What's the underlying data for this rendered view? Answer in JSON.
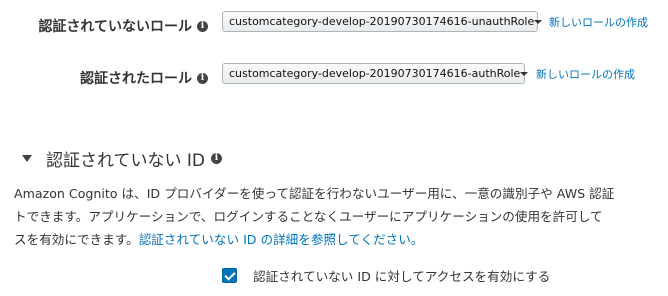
{
  "unauth_role": {
    "label": "認証されていないロール",
    "selected": "customcategory-develop-20190730174616-unauthRole",
    "create_link": "新しいロールの作成"
  },
  "auth_role": {
    "label": "認証されたロール",
    "selected": "customcategory-develop-20190730174616-authRole",
    "create_link": "新しいロールの作成"
  },
  "section": {
    "title": "認証されていない ID",
    "description_lines": [
      "Amazon Cognito は、ID プロバイダーを使って認証を行わないユーザー用に、一意の識別子や AWS 認証",
      "トできます。アプリケーションで、ログインすることなくユーザーにアプリケーションの使用を許可して",
      "スを有効にできます。"
    ],
    "details_link": "認証されていない ID の詳細を参照してください。",
    "checkbox_label": "認証されていない ID に対してアクセスを有効にする",
    "checkbox_checked": true
  },
  "icons": {
    "info": "i",
    "info_name": "info-icon",
    "caret_name": "caret-down-icon",
    "section_toggle_name": "triangle-down-icon"
  },
  "colors": {
    "link": "#0073bb",
    "checkbox": "#0073bb",
    "text": "#333333"
  }
}
